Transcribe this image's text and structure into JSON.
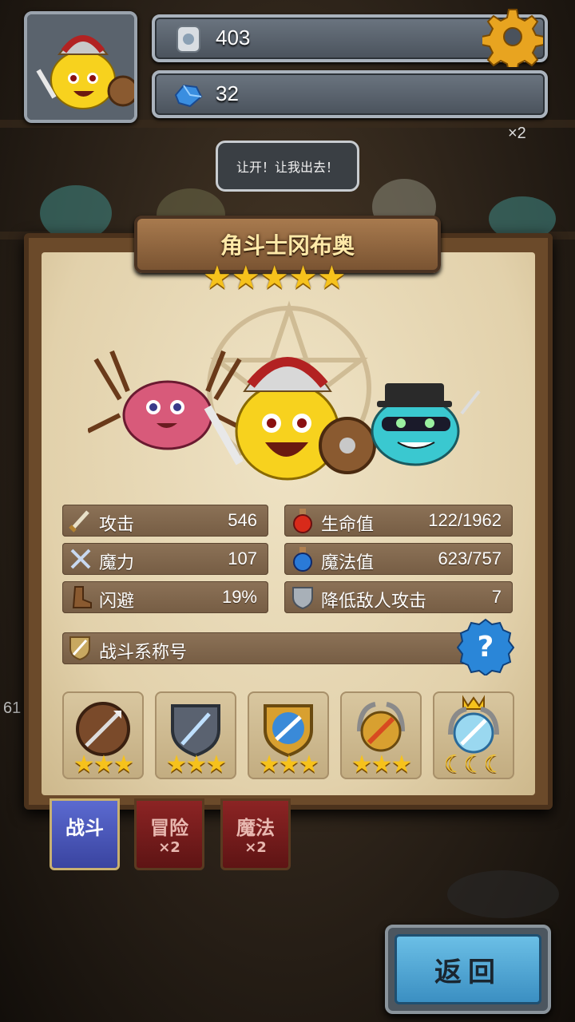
{
  "hud": {
    "stone_count": "403",
    "gem_count": "32",
    "bg_counter": "×2",
    "bg_side_number": "61"
  },
  "speech_bubble": "让开！让我出去！",
  "hero": {
    "name": "角斗士冈布奥",
    "stars": "★★★★★",
    "star_rating": 5
  },
  "stats": [
    {
      "icon": "sword-icon",
      "label": "攻击",
      "value": "546"
    },
    {
      "icon": "red-potion-icon",
      "label": "生命值",
      "value": "122/1962"
    },
    {
      "icon": "magic-staff-icon",
      "label": "魔力",
      "value": "107"
    },
    {
      "icon": "blue-potion-icon",
      "label": "魔法值",
      "value": "623/757"
    },
    {
      "icon": "boot-icon",
      "label": "闪避",
      "value": "19%"
    },
    {
      "icon": "shield-icon",
      "label": "降低敌人攻击",
      "value": "7"
    }
  ],
  "battle_title": {
    "label": "战斗系称号",
    "help": "?"
  },
  "skills": [
    {
      "name": "spear-shield-skill",
      "stars": "★★★"
    },
    {
      "name": "dagger-shield-skill",
      "stars": "★★★"
    },
    {
      "name": "gold-blade-skill",
      "stars": "★★★"
    },
    {
      "name": "laurel-sword-skill",
      "stars": "★★★"
    },
    {
      "name": "crown-sword-skill",
      "stars": "☾☾☾"
    }
  ],
  "tabs": [
    {
      "label": "战斗",
      "mult": "",
      "active": true
    },
    {
      "label": "冒险",
      "mult": "×2",
      "active": false
    },
    {
      "label": "魔法",
      "mult": "×2",
      "active": false
    }
  ],
  "back_label": "返回",
  "colors": {
    "gold_star": "#f6c21c",
    "active_tab": "#4a56b8",
    "inactive_tab": "#7a1c1c",
    "back_button": "#4fa6d6"
  }
}
